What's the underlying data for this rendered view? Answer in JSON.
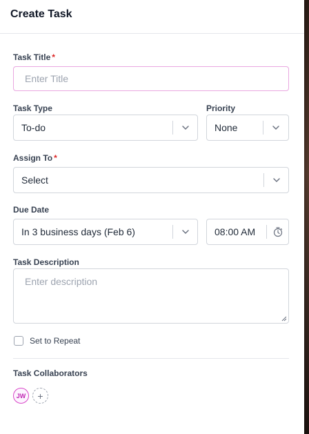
{
  "header": {
    "title": "Create Task"
  },
  "form": {
    "task_title": {
      "label": "Task Title",
      "required_mark": "*",
      "placeholder": "Enter Title"
    },
    "task_type": {
      "label": "Task Type",
      "value": "To-do"
    },
    "priority": {
      "label": "Priority",
      "value": "None"
    },
    "assign_to": {
      "label": "Assign To",
      "required_mark": "*",
      "value": "Select"
    },
    "due_date": {
      "label": "Due Date",
      "date_value": "In 3 business days (Feb 6)",
      "time_value": "08:00 AM"
    },
    "description": {
      "label": "Task Description",
      "placeholder": "Enter description"
    },
    "repeat": {
      "label": "Set to Repeat",
      "checked": false
    },
    "collaborators": {
      "label": "Task Collaborators",
      "avatars": [
        "JW"
      ],
      "add_symbol": "+"
    }
  },
  "colors": {
    "required": "#dc2626",
    "focus_border": "#e9a6e0",
    "avatar_accent": "#d946c8"
  }
}
